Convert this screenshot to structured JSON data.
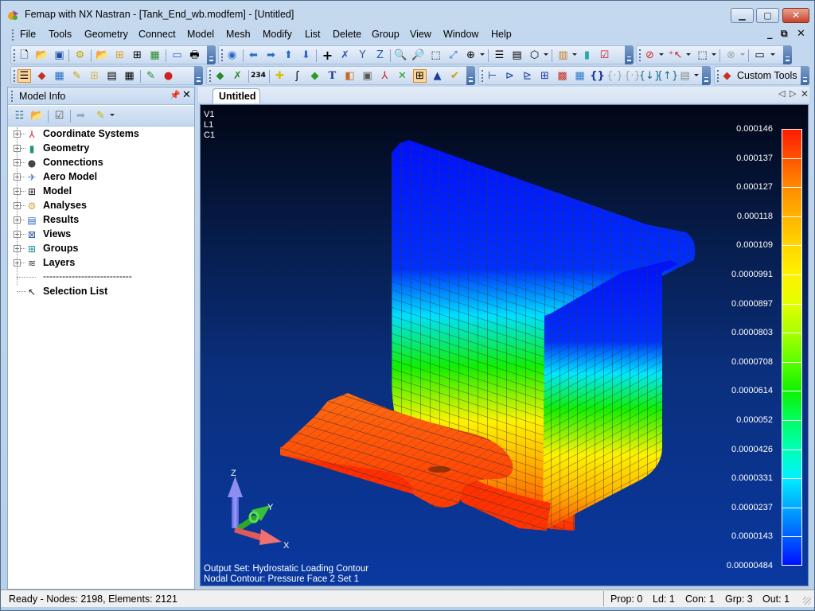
{
  "window": {
    "title": "Femap with NX Nastran - [Tank_End_wb.modfem] - [Untitled]",
    "controls": {
      "minimize": "—",
      "maximize": "▫",
      "close": "✕"
    }
  },
  "menubar": {
    "items": [
      "File",
      "Tools",
      "Geometry",
      "Connect",
      "Model",
      "Mesh",
      "Modify",
      "List",
      "Delete",
      "Group",
      "View",
      "Window",
      "Help"
    ],
    "mdi_controls": {
      "minimize": "_",
      "restore": "🗗",
      "close": "✕"
    }
  },
  "toolbars": {
    "custom_tools_label": "Custom Tools"
  },
  "model_info": {
    "title": "Model Info",
    "pin": "⊥",
    "close": "✕",
    "tree": [
      {
        "label": "Coordinate Systems",
        "icon": "coordinate-systems-icon",
        "glyph": "⅄"
      },
      {
        "label": "Geometry",
        "icon": "geometry-icon",
        "glyph": "▮"
      },
      {
        "label": "Connections",
        "icon": "connections-icon",
        "glyph": "●"
      },
      {
        "label": "Aero Model",
        "icon": "aero-model-icon",
        "glyph": "✈"
      },
      {
        "label": "Model",
        "icon": "model-icon",
        "glyph": "⊞"
      },
      {
        "label": "Analyses",
        "icon": "analyses-icon",
        "glyph": "⚙"
      },
      {
        "label": "Results",
        "icon": "results-icon",
        "glyph": "▤"
      },
      {
        "label": "Views",
        "icon": "views-icon",
        "glyph": "⊠"
      },
      {
        "label": "Groups",
        "icon": "groups-icon",
        "glyph": "⊞"
      },
      {
        "label": "Layers",
        "icon": "layers-icon",
        "glyph": "≋"
      }
    ],
    "separator": "----------------------------",
    "selection_list": "Selection List"
  },
  "tabs": [
    {
      "label": "Untitled",
      "active": true
    }
  ],
  "viewport": {
    "labels": [
      "V1",
      "L1",
      "C1"
    ],
    "footer": {
      "output_set": "Output Set: Hydrostatic Loading Contour",
      "nodal_contour": "Nodal Contour: Pressure Face 2 Set 1"
    },
    "axes": {
      "x": "X",
      "y": "Y",
      "z": "Z"
    },
    "legend": {
      "values": [
        "0.000146",
        "0.000137",
        "0.000127",
        "0.000118",
        "0.000109",
        "0.0000991",
        "0.0000897",
        "0.0000803",
        "0.0000708",
        "0.0000614",
        "0.000052",
        "0.0000426",
        "0.0000331",
        "0.0000237",
        "0.0000143",
        "0.00000484"
      ],
      "colors": [
        "#ff1a00",
        "#ff5500",
        "#ff8c00",
        "#ffb400",
        "#ffd600",
        "#fff200",
        "#e4ff00",
        "#a8ff00",
        "#5cff00",
        "#10f000",
        "#00ff60",
        "#00ffb4",
        "#00f0ff",
        "#00a8ff",
        "#0060ff",
        "#0010ff"
      ]
    }
  },
  "statusbar": {
    "text": "Ready - Nodes: 2198,  Elements: 2121",
    "panes": [
      "Prop: 0",
      "Ld: 1",
      "Con: 1",
      "Grp: 3",
      "Out: 1"
    ]
  },
  "colors": {
    "viewport_top": "#020716",
    "viewport_bottom": "#0a38a0",
    "accent": "#3e6aa8"
  }
}
